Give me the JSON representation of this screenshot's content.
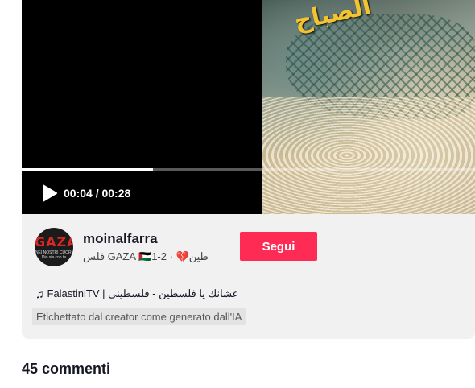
{
  "player": {
    "current_time": "00:04",
    "duration": "00:28",
    "time_display": "00:04 / 00:28",
    "progress_fraction": 0.29,
    "overlay_text": "الصباح"
  },
  "creator": {
    "avatar_text": "GAZA",
    "avatar_subtext": "NEI NOSTRI CUORI Dio sia con te",
    "username": "moinalfarra",
    "meta": "فلس GAZA 🇵🇸طين💔 · 2-1",
    "follow_label": "Segui"
  },
  "music": {
    "icon": "music-note-icon",
    "label": "FalastiniTV | عشانك يا فلسطين - فلسطيني"
  },
  "ai_label": "Etichettato dal creator come generato dall'IA",
  "comments": {
    "count_label": "45 commenti"
  },
  "colors": {
    "accent": "#fe2c55",
    "card_bg": "#f1f1f2"
  }
}
